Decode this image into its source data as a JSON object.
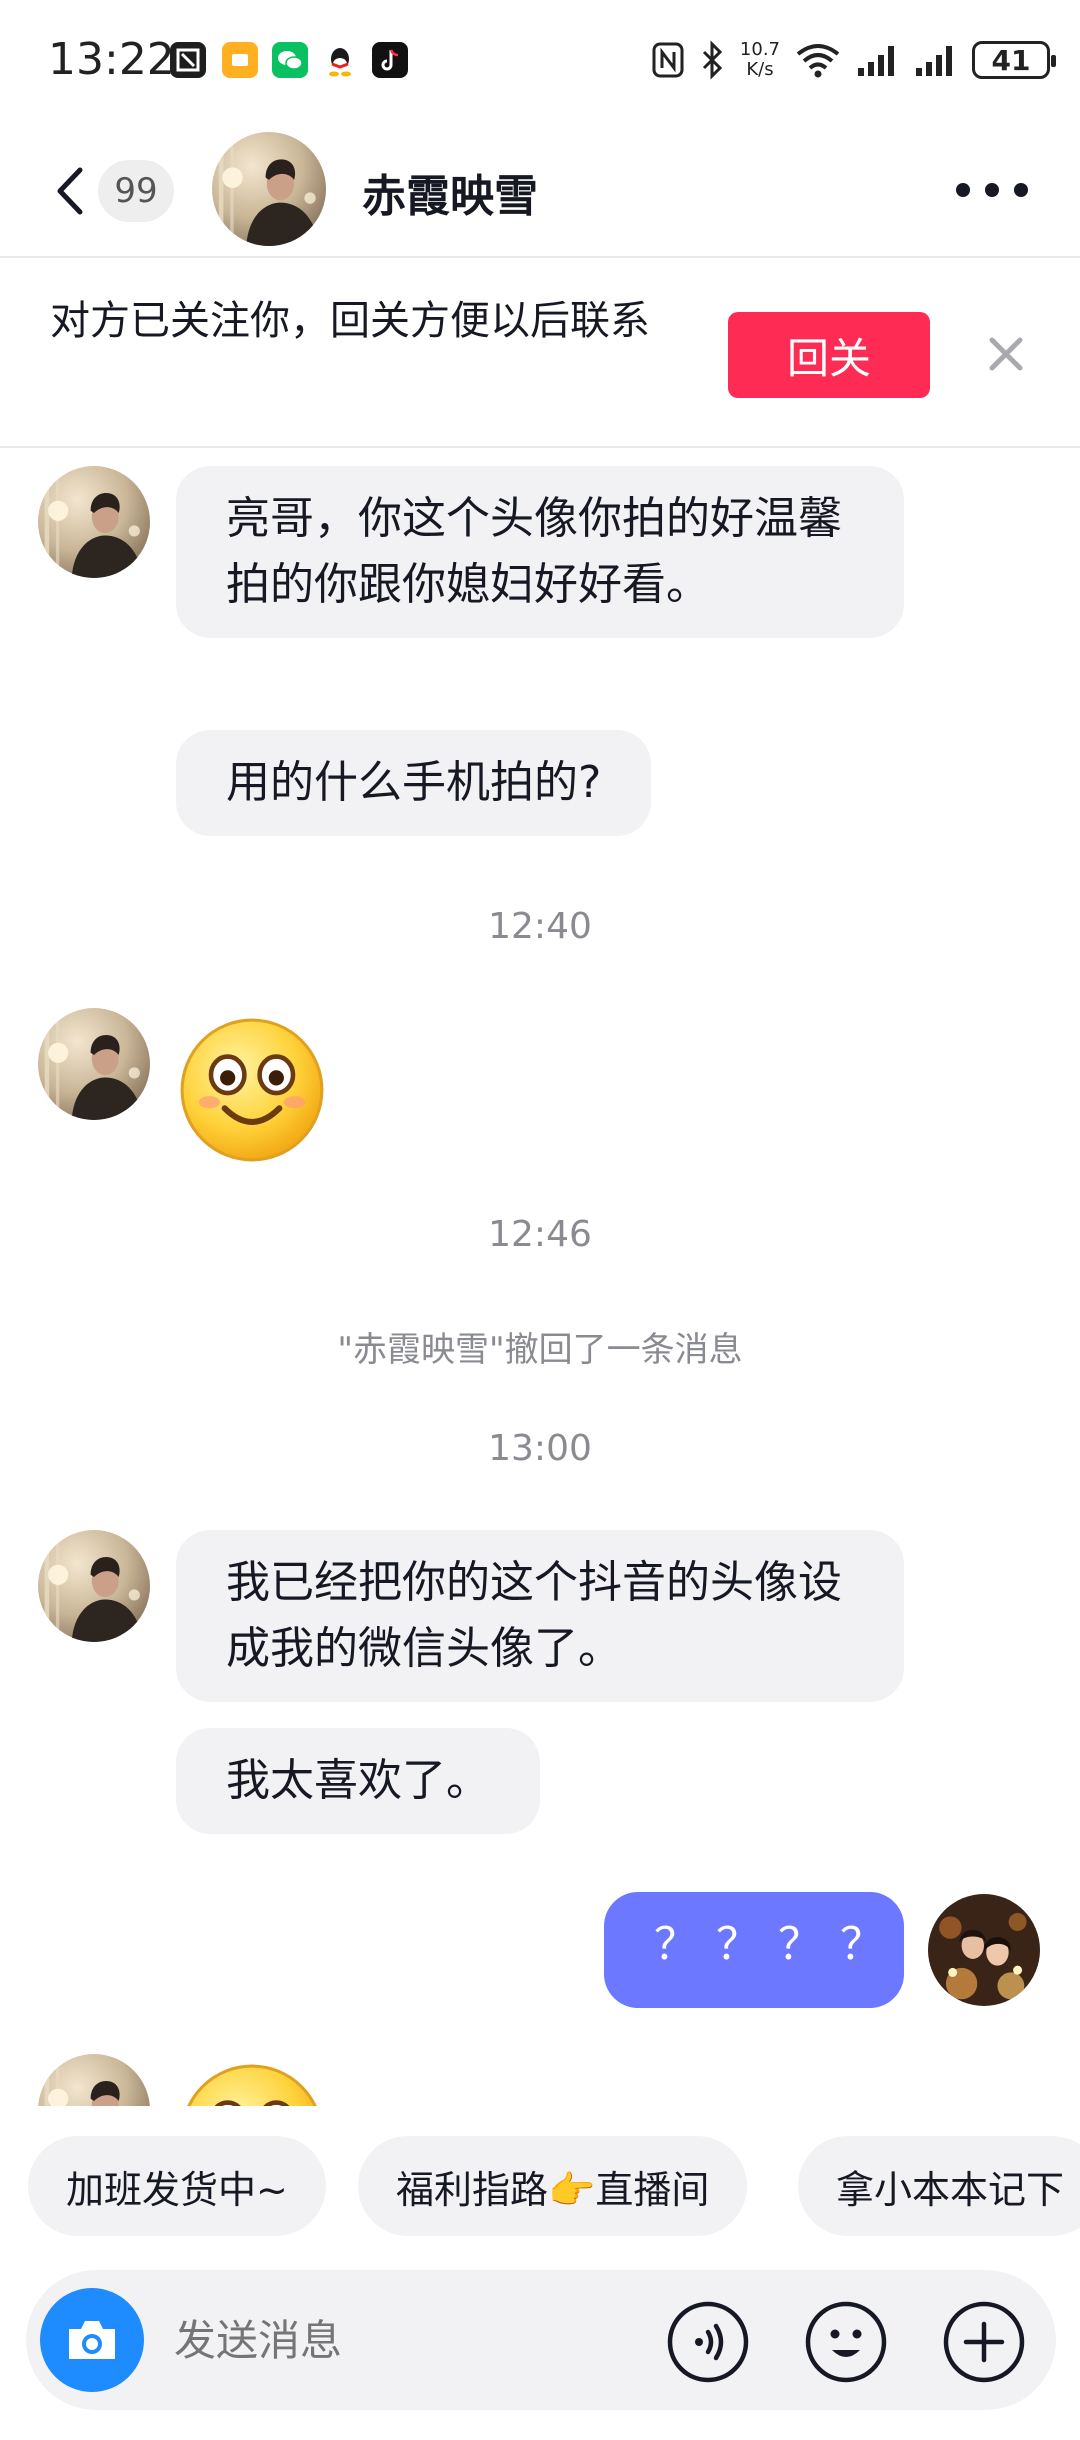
{
  "status_bar": {
    "time": "13:22",
    "net_speed_value": "10.7",
    "net_speed_unit": "K/s",
    "battery": "41",
    "icons": [
      "screenshot-app-icon",
      "orange-app-icon",
      "wechat-icon",
      "qq-icon",
      "tiktok-icon",
      "nfc-icon",
      "bluetooth-icon",
      "wifi-icon",
      "signal-icon",
      "signal-icon",
      "battery-icon"
    ]
  },
  "header": {
    "unread_count": "99",
    "contact_name": "赤霞映雪",
    "icons": [
      "back-icon",
      "more-icon"
    ]
  },
  "follow_banner": {
    "text": "对方已关注你，回关方便以后联系",
    "follow_button": "回关",
    "accent_color": "#fe2c55"
  },
  "chat": {
    "bubble_color": "#f2f2f4",
    "my_bubble_color": "#6b78ff",
    "messages": [
      {
        "type": "text",
        "from": "contact",
        "text": "亮哥，你这个头像你拍的好温馨拍的你跟你媳妇好好看。"
      },
      {
        "type": "text",
        "from": "contact",
        "text": "用的什么手机拍的?"
      },
      {
        "type": "time",
        "text": "12:40"
      },
      {
        "type": "emoji",
        "from": "contact",
        "emoji": "smiling-face"
      },
      {
        "type": "time",
        "text": "12:46"
      },
      {
        "type": "system",
        "text": "\"赤霞映雪\"撤回了一条消息"
      },
      {
        "type": "time",
        "text": "13:00"
      },
      {
        "type": "text",
        "from": "contact",
        "text": "我已经把你的这个抖音的头像设成我的微信头像了。"
      },
      {
        "type": "text",
        "from": "contact",
        "text": "我太喜欢了。"
      },
      {
        "type": "text",
        "from": "me",
        "text": "？？？？"
      },
      {
        "type": "emoji",
        "from": "contact",
        "emoji": "smiling-face"
      }
    ]
  },
  "quick_replies": [
    "加班发货中~",
    "福利指路👉直播间",
    "拿小本本记下"
  ],
  "input_bar": {
    "placeholder": "发送消息",
    "camera_color": "#1e8bff",
    "icons": [
      "camera-icon",
      "voice-icon",
      "emoji-icon",
      "plus-icon"
    ]
  }
}
